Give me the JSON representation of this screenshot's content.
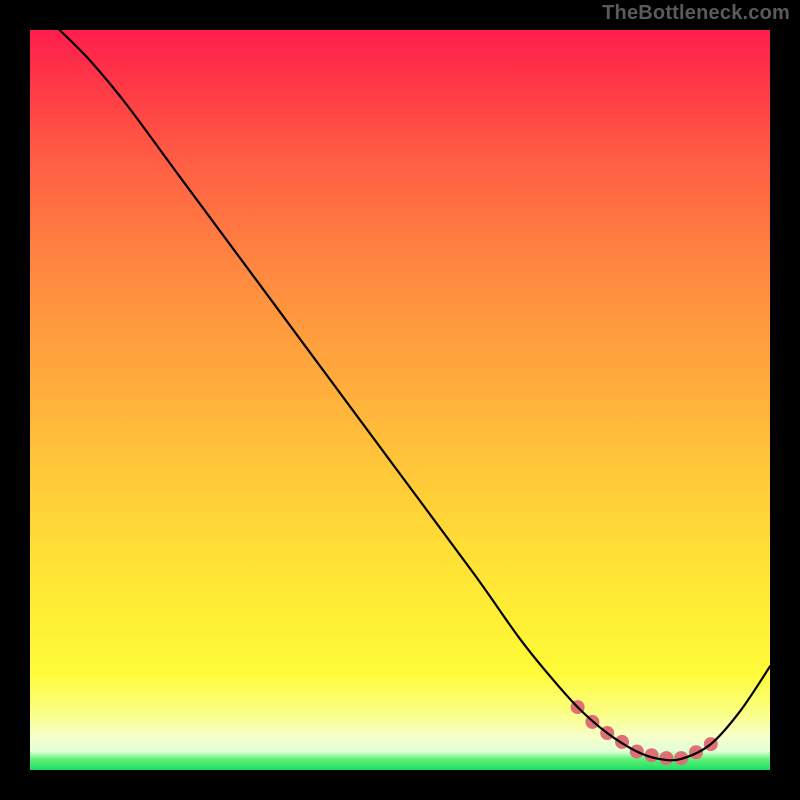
{
  "watermark": "TheBottleneck.com",
  "chart_data": {
    "type": "line",
    "title": "",
    "xlabel": "",
    "ylabel": "",
    "xlim": [
      0,
      100
    ],
    "ylim": [
      0,
      100
    ],
    "grid": false,
    "series": [
      {
        "name": "bottleneck-curve",
        "x": [
          4,
          8,
          13,
          20,
          30,
          40,
          50,
          60,
          66,
          70,
          74,
          78,
          82,
          85,
          88,
          92,
          96,
          100
        ],
        "y": [
          100,
          96,
          90,
          80.5,
          67,
          53.5,
          40,
          26.5,
          18,
          13,
          8.5,
          5,
          2.5,
          1.5,
          1.5,
          3.5,
          8,
          14
        ]
      }
    ],
    "marker_region": {
      "name": "bottom-pink-markers",
      "x": [
        74,
        76,
        78,
        80,
        82,
        84,
        86,
        88,
        90,
        92
      ],
      "y": [
        8.5,
        6.5,
        5.0,
        3.8,
        2.5,
        2.0,
        1.6,
        1.6,
        2.4,
        3.5
      ],
      "color": "#dd6f75",
      "radius": 7
    },
    "colors": {
      "curve_stroke": "#000000",
      "background_top": "#ff1e4c",
      "background_bottom": "#18e060"
    }
  }
}
